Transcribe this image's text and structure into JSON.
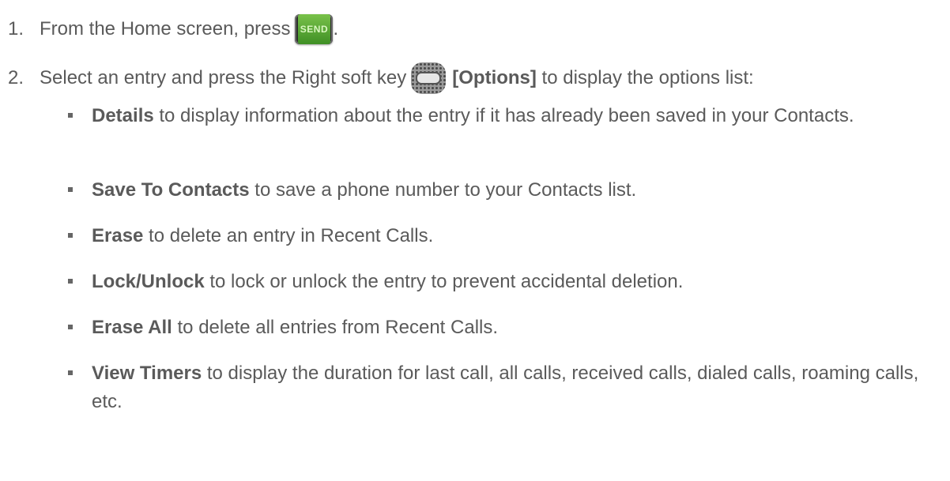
{
  "steps": [
    {
      "num": "1.",
      "text_before": "From the Home screen, press",
      "key_icon": "send-key",
      "key_label": "SEND",
      "text_after": "."
    },
    {
      "num": "2.",
      "text_before": "Select an entry and press the Right soft key",
      "key_icon": "right-soft-key",
      "key_label": "[Options]",
      "text_after": " to display the options list:"
    }
  ],
  "options": [
    {
      "term": "Details",
      "desc": " to display information about the entry if it has already been saved in your Contacts."
    },
    {
      "term": "Save To Contacts",
      "desc": " to save a phone number to your Contacts list."
    },
    {
      "term": "Erase",
      "desc": " to delete an entry in Recent Calls."
    },
    {
      "term": "Lock/Unlock",
      "desc": " to lock or unlock the entry to prevent accidental deletion."
    },
    {
      "term": "Erase All",
      "desc": " to delete all entries from Recent Calls."
    },
    {
      "term": "View Timers",
      "desc": " to display the duration for last call, all calls, received calls, dialed calls, roaming calls, etc."
    }
  ]
}
